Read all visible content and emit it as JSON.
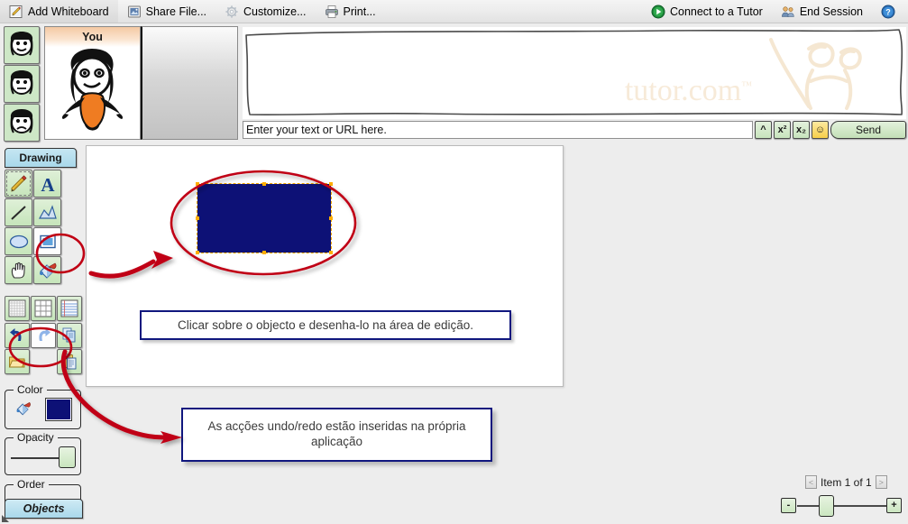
{
  "topbar": {
    "items": [
      {
        "label": "Add Whiteboard",
        "icon": "whiteboard-pencil-icon"
      },
      {
        "label": "Share File...",
        "icon": "share-file-icon"
      },
      {
        "label": "Customize...",
        "icon": "customize-gear-icon"
      },
      {
        "label": "Print...",
        "icon": "printer-icon"
      }
    ],
    "right_items": [
      {
        "label": "Connect to a Tutor",
        "icon": "connect-play-icon"
      },
      {
        "label": "End Session",
        "icon": "end-session-people-icon"
      }
    ],
    "help_icon": "help-question-icon"
  },
  "participants": {
    "active_label": "You",
    "thumbnail_count": 3,
    "thumb_icons": [
      "avatar-smiling-icon",
      "avatar-neutral-icon",
      "avatar-frowning-icon"
    ],
    "avatar_icon": "avatar-stick-figure"
  },
  "chat": {
    "watermark": "tutor.com",
    "watermark_tm": "™",
    "input_value": "Enter your text or URL here.",
    "input_placeholder": "Enter your text or URL here.",
    "buttons": [
      {
        "label": "^",
        "name": "caret-button"
      },
      {
        "label": "x²",
        "name": "superscript-button"
      },
      {
        "label": "x₂",
        "name": "subscript-button"
      },
      {
        "label": "☺",
        "name": "emoticon-button"
      }
    ],
    "send_label": "Send"
  },
  "palette": {
    "drawing_tab_label": "Drawing",
    "objects_tab_label": "Objects",
    "tools": [
      {
        "name": "pencil-tool",
        "icon": "pencil-icon",
        "selected": true
      },
      {
        "name": "text-tool",
        "icon": "letter-a-icon",
        "selected": false
      },
      {
        "name": "line-tool",
        "icon": "line-icon",
        "selected": false
      },
      {
        "name": "polygon-tool",
        "icon": "polygon-icon",
        "selected": false
      },
      {
        "name": "ellipse-tool",
        "icon": "ellipse-icon",
        "selected": false
      },
      {
        "name": "rectangle-tool",
        "icon": "rectangle-icon",
        "selected": true
      },
      {
        "name": "pan-tool",
        "icon": "hand-icon",
        "selected": false
      },
      {
        "name": "fill-tool",
        "icon": "paint-bucket-icon",
        "selected": false
      }
    ],
    "sheets": [
      {
        "name": "grid-fine-button",
        "icon": "grid-fine-icon"
      },
      {
        "name": "grid-coarse-button",
        "icon": "grid-coarse-icon"
      },
      {
        "name": "ruled-paper-button",
        "icon": "ruled-lines-icon"
      }
    ],
    "actions": [
      {
        "name": "undo-button",
        "icon": "undo-arrow-icon"
      },
      {
        "name": "redo-button",
        "icon": "redo-arrow-icon"
      },
      {
        "name": "copy-button",
        "icon": "copy-pages-icon"
      },
      {
        "name": "open-button",
        "icon": "open-folder-icon"
      },
      {
        "name": "paste-button",
        "icon": "paste-clipboard-icon"
      }
    ],
    "color_group_label": "Color",
    "color_swatch_hex": "#0d1176",
    "color_picker_icon": "paint-bucket-icon",
    "opacity_group_label": "Opacity",
    "order_group_label": "Order"
  },
  "canvas": {
    "shape": {
      "name": "navy-rectangle",
      "fill_hex": "#0d1176",
      "selected": true,
      "handle_hex": "#ffae00"
    },
    "callout_1": "Clicar sobre o objecto e desenha-lo na área de edição.",
    "callout_2": "As acções undo/redo estão inseridas na própria aplicação",
    "callout_border_hex": "#10177e"
  },
  "annotations": {
    "highlight_color_hex": "#c00014",
    "marks": [
      {
        "name": "ellipse-around-rectangle-tool",
        "shape": "ellipse"
      },
      {
        "name": "ellipse-around-canvas-rectangle",
        "shape": "ellipse"
      },
      {
        "name": "ellipse-around-undo-redo",
        "shape": "ellipse"
      },
      {
        "name": "arrow-tool-to-shape",
        "shape": "arrow"
      },
      {
        "name": "arrow-undo-to-callout",
        "shape": "arrow"
      }
    ]
  },
  "footer": {
    "item_counter": "Item 1 of 1",
    "prev_label": "<",
    "next_label": ">",
    "zoom_out_label": "-",
    "zoom_in_label": "+"
  }
}
